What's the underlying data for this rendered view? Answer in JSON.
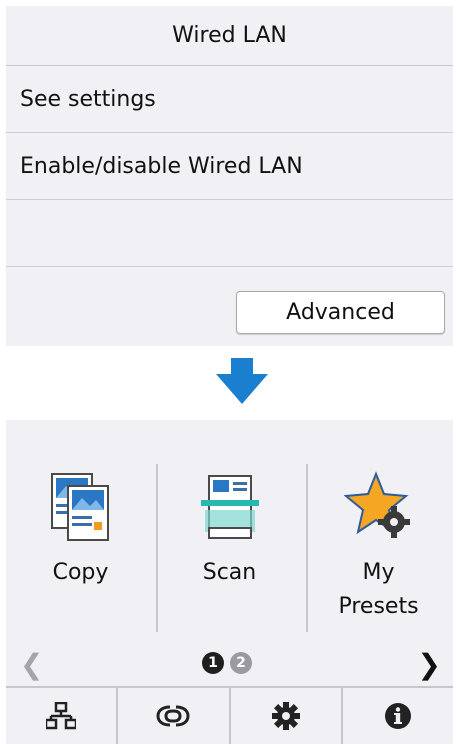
{
  "settings_panel": {
    "title": "Wired LAN",
    "items": [
      {
        "label": "See settings"
      },
      {
        "label": "Enable/disable Wired LAN"
      },
      {
        "label": ""
      }
    ],
    "advanced_label": "Advanced"
  },
  "home": {
    "tiles": [
      {
        "label": "Copy",
        "icon": "copy-icon"
      },
      {
        "label": "Scan",
        "icon": "scan-icon"
      },
      {
        "label": "My\nPresets",
        "icon": "my-presets-icon"
      }
    ],
    "pager": {
      "page1": "1",
      "page2": "2"
    },
    "bottom_bar": [
      "network-icon",
      "wireless-connect-icon",
      "gear-icon",
      "info-icon"
    ]
  },
  "colors": {
    "panel_bg": "#f1f0f4",
    "arrow": "#1b7fd0"
  }
}
